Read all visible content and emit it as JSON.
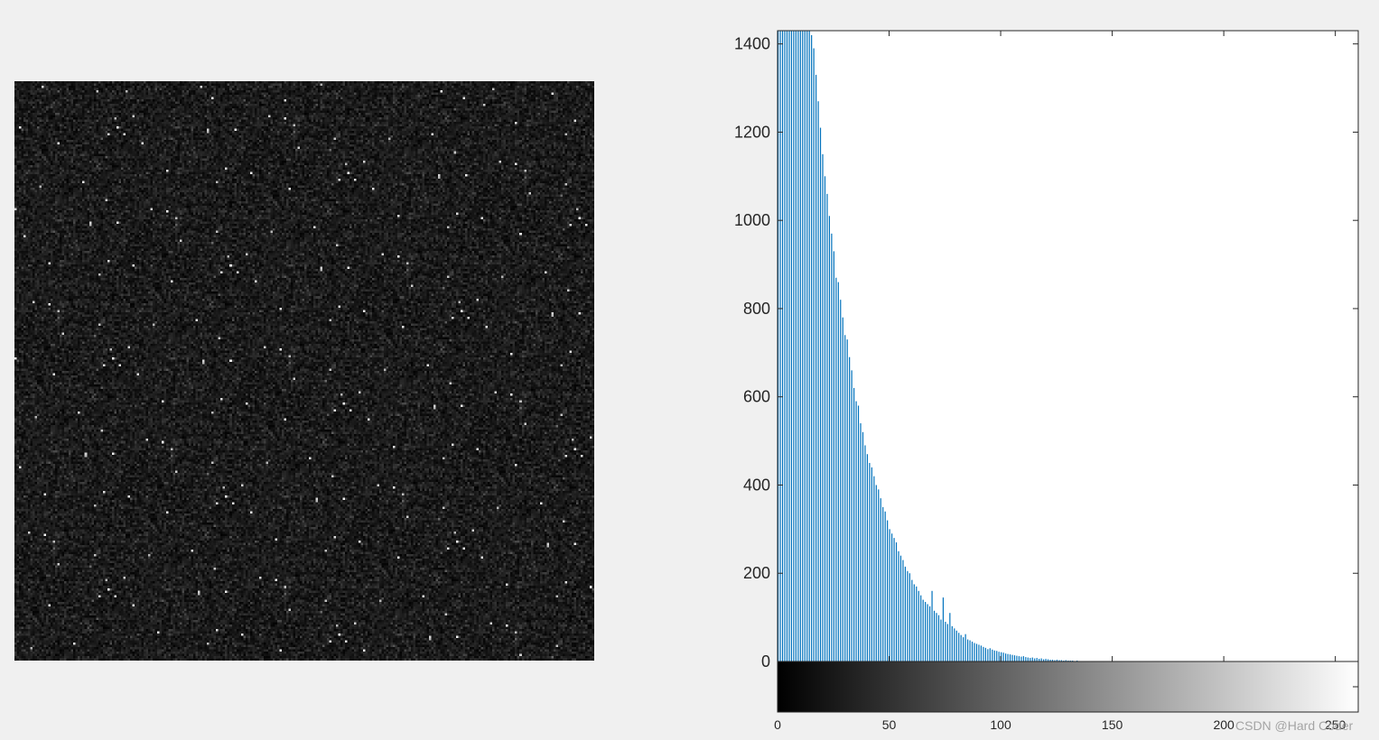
{
  "figure": {
    "background": "#f0f0f0",
    "left_image": {
      "description_name": "noise-image",
      "pixel_grid": 256,
      "base_color": "#1a1a1a"
    },
    "watermark": "CSDN @Hard Coder"
  },
  "chart_data": {
    "type": "bar",
    "xlim": [
      0,
      255
    ],
    "ylim": [
      -110,
      1430
    ],
    "x_ticks": [
      0,
      50,
      100,
      150,
      200,
      250
    ],
    "y_ticks": [
      0,
      200,
      400,
      600,
      800,
      1000,
      1200,
      1400
    ],
    "bar_color": "#0072bd",
    "colorbar": "grayscale 0-255",
    "series": [
      {
        "bins_start": 0,
        "values": [
          1430,
          1430,
          1430,
          1430,
          1430,
          1430,
          1430,
          1430,
          1430,
          1430,
          1430,
          1430,
          1430,
          1430,
          1430,
          1420,
          1390,
          1330,
          1270,
          1210,
          1150,
          1100,
          1060,
          1010,
          970,
          930,
          870,
          860,
          820,
          780,
          740,
          730,
          690,
          660,
          620,
          590,
          580,
          540,
          520,
          490,
          470,
          450,
          440,
          420,
          400,
          390,
          370,
          350,
          340,
          320,
          300,
          290,
          280,
          270,
          250,
          240,
          230,
          215,
          205,
          200,
          185,
          175,
          170,
          160,
          150,
          140,
          135,
          130,
          125,
          160,
          115,
          110,
          105,
          95,
          145,
          90,
          85,
          110,
          80,
          75,
          70,
          65,
          60,
          55,
          62,
          50,
          48,
          45,
          42,
          40,
          38,
          36,
          33,
          31,
          28,
          30,
          27,
          25,
          24,
          22,
          21,
          20,
          18,
          17,
          16,
          15,
          14,
          13,
          12,
          11,
          12,
          10,
          9,
          8,
          9,
          7,
          8,
          6,
          7,
          5,
          6,
          5,
          4,
          4,
          3,
          4,
          3,
          3,
          2,
          3,
          2,
          2,
          2,
          1,
          2,
          1,
          1,
          1,
          1,
          1,
          0,
          1,
          0,
          1,
          0,
          0,
          1,
          0,
          0,
          0,
          0,
          1,
          0,
          0,
          0,
          0,
          0,
          0,
          0,
          0,
          0,
          0,
          0,
          0,
          0,
          0,
          0,
          0,
          0,
          0,
          0,
          0,
          0,
          0,
          0,
          0,
          0,
          0,
          0,
          0,
          0,
          0,
          0,
          0,
          0,
          0,
          0,
          0,
          0,
          0,
          0,
          0,
          0,
          0,
          0,
          0,
          0,
          0,
          0,
          0,
          0,
          0,
          0,
          0,
          0,
          0,
          0,
          0,
          0,
          0,
          0,
          0,
          0,
          0,
          0,
          0,
          0,
          0,
          0,
          0,
          0,
          0,
          0,
          0,
          0,
          0,
          0,
          0,
          0,
          0,
          0,
          0,
          0,
          0,
          0,
          0,
          0,
          0,
          0,
          0,
          0,
          0,
          0,
          0,
          0,
          0,
          0,
          0,
          0,
          0,
          0,
          0,
          0,
          0,
          0,
          0,
          0,
          0,
          0,
          0,
          0,
          0,
          0,
          0,
          0,
          0,
          0,
          0,
          0,
          0,
          0,
          0,
          0,
          0,
          0
        ]
      }
    ]
  }
}
